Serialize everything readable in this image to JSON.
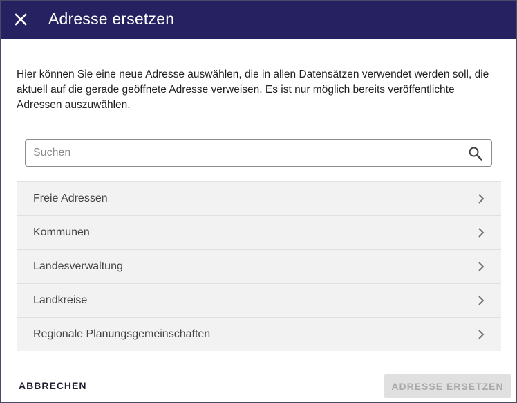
{
  "dialog": {
    "title": "Adresse ersetzen",
    "close_icon": "close-icon",
    "header_color": "#262160"
  },
  "description": "Hier können Sie eine neue Adresse auswählen, die in allen Datensätzen verwendet werden soll, die aktuell auf die gerade geöffnete Adresse verweisen. Es ist nur möglich bereits veröffentlichte Adressen auszuwählen.",
  "search": {
    "placeholder": "Suchen",
    "value": "",
    "icon": "search-icon"
  },
  "categories": [
    {
      "label": "Freie Adressen",
      "icon": "chevron-right-icon"
    },
    {
      "label": "Kommunen",
      "icon": "chevron-right-icon"
    },
    {
      "label": "Landesverwaltung",
      "icon": "chevron-right-icon"
    },
    {
      "label": "Landkreise",
      "icon": "chevron-right-icon"
    },
    {
      "label": "Regionale Planungsgemeinschaften",
      "icon": "chevron-right-icon"
    }
  ],
  "footer": {
    "cancel_label": "ABBRECHEN",
    "replace_label": "ADRESSE ERSETZEN",
    "replace_disabled": true
  }
}
